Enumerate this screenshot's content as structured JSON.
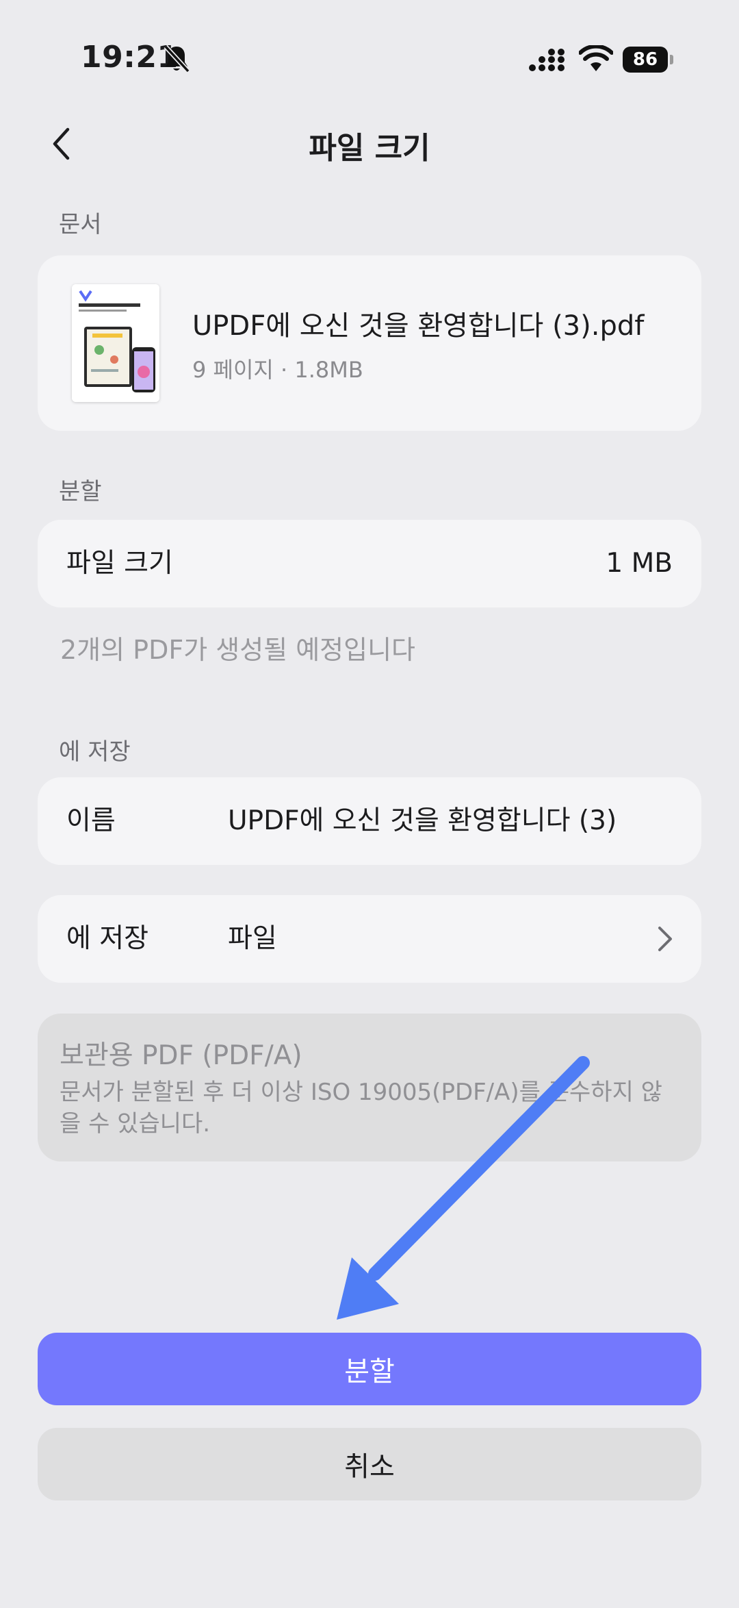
{
  "status_bar": {
    "time": "19:21",
    "battery": "86",
    "icons": [
      "bell-off-icon",
      "signal-icon",
      "wifi-icon",
      "battery-icon"
    ]
  },
  "nav": {
    "title": "파일 크기",
    "back_icon": "chevron-left-icon"
  },
  "document_section": {
    "label": "문서",
    "file_name": "UPDF에 오신 것을 환영합니다 (3).pdf",
    "file_meta": "9 페이지 · 1.8MB"
  },
  "split_section": {
    "label": "분할",
    "row_label": "파일 크기",
    "row_value": "1 MB",
    "hint": "2개의 PDF가 생성될 예정입니다"
  },
  "save_section": {
    "label": "에 저장",
    "name_label": "이름",
    "name_value": "UPDF에 오신 것을 환영합니다 (3)",
    "location_label": "에 저장",
    "location_value": "파일"
  },
  "archive": {
    "title": "보관용 PDF (PDF/A)",
    "description": "문서가 분할된 후 더 이상 ISO 19005(PDF/A)를 준수하지 않을 수 있습니다."
  },
  "buttons": {
    "primary": "분할",
    "secondary": "취소"
  },
  "colors": {
    "background": "#ebebee",
    "card": "#f5f5f7",
    "primary_button": "#7478fd",
    "annotation_arrow": "#4f7df5"
  }
}
